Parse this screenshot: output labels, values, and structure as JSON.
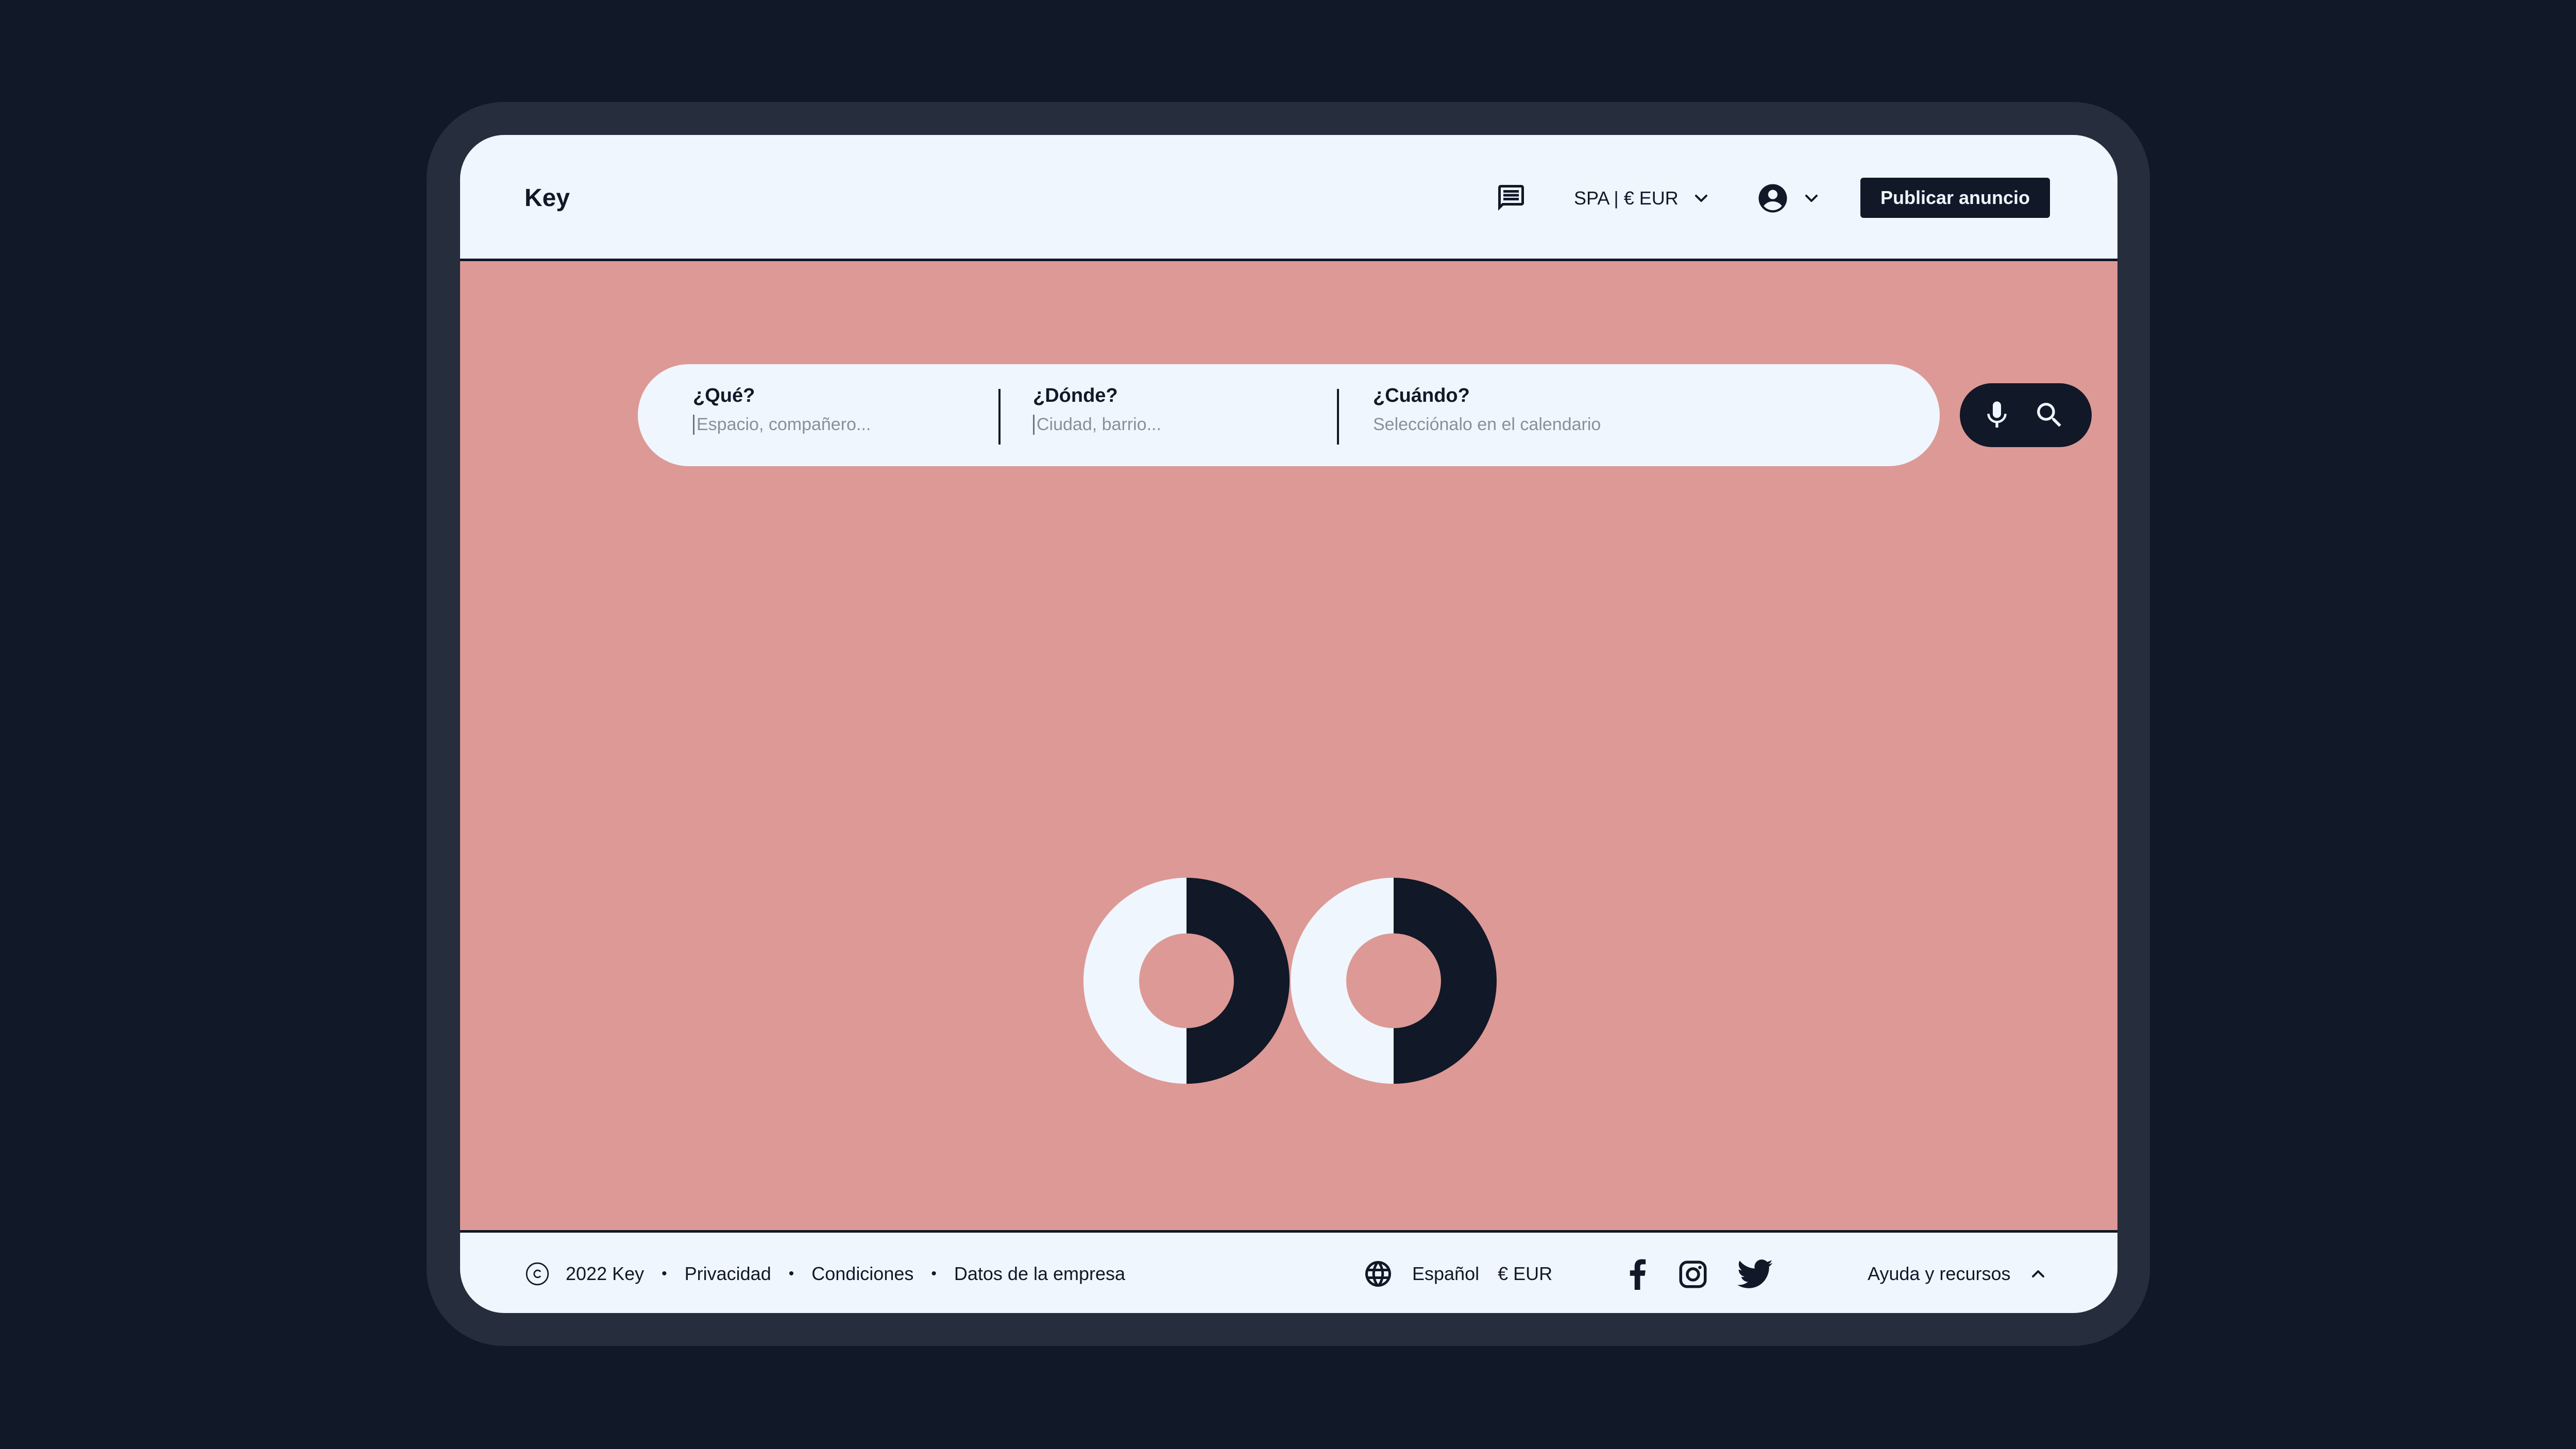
{
  "header": {
    "logo": "Key",
    "locale_label": "SPA | € EUR",
    "publish_label": "Publicar anuncio"
  },
  "search": {
    "what_label": "¿Qué?",
    "what_placeholder": "Espacio, compañero...",
    "where_label": "¿Dónde?",
    "where_placeholder": "Ciudad, barrio...",
    "when_label": "¿Cuándo?",
    "when_placeholder": "Selecciónalo en el calendario"
  },
  "footer": {
    "copyright": "2022 Key",
    "links": [
      "Privacidad",
      "Condiciones",
      "Datos de la empresa"
    ],
    "separator": "•",
    "language": "Español",
    "currency": "€ EUR",
    "help_label": "Ayuda y recursos"
  },
  "icons": {
    "messages": "chat-icon",
    "locale_chevron": "chevron-down-icon",
    "user": "account-circle-icon",
    "mic": "microphone-icon",
    "search": "search-icon",
    "copyright": "copyright-icon",
    "globe": "globe-icon",
    "social": [
      "facebook-icon",
      "instagram-icon",
      "twitter-icon"
    ],
    "help_chevron": "chevron-up-icon"
  },
  "colors": {
    "page_bg": "#111827",
    "device_frame": "#262d3d",
    "surface": "#eff6fe",
    "hero_bg": "#dd9996",
    "ink": "#111827"
  }
}
